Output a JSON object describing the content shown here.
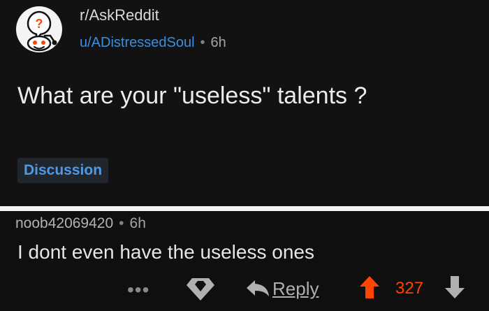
{
  "post": {
    "subreddit": "r/AskReddit",
    "author": "u/ADistressedSoul",
    "separator": "•",
    "age": "6h",
    "title": "What are your \"useless\" talents ?",
    "flair": "Discussion",
    "avatar_icon": "askreddit-icon"
  },
  "comment": {
    "author": "noob42069420",
    "separator": "•",
    "age": "6h",
    "body": "I dont  even have the useless ones",
    "actions": {
      "more_icon": "more-icon",
      "award_icon": "award-icon",
      "reply_icon": "reply-arrow-icon",
      "reply_label": "Reply",
      "upvote_icon": "upvote-arrow-icon",
      "score": "327",
      "downvote_icon": "downvote-arrow-icon"
    }
  },
  "colors": {
    "accent": "#ff4500",
    "link_blue": "#3b8ede",
    "flair_blue": "#4d9ae6"
  }
}
